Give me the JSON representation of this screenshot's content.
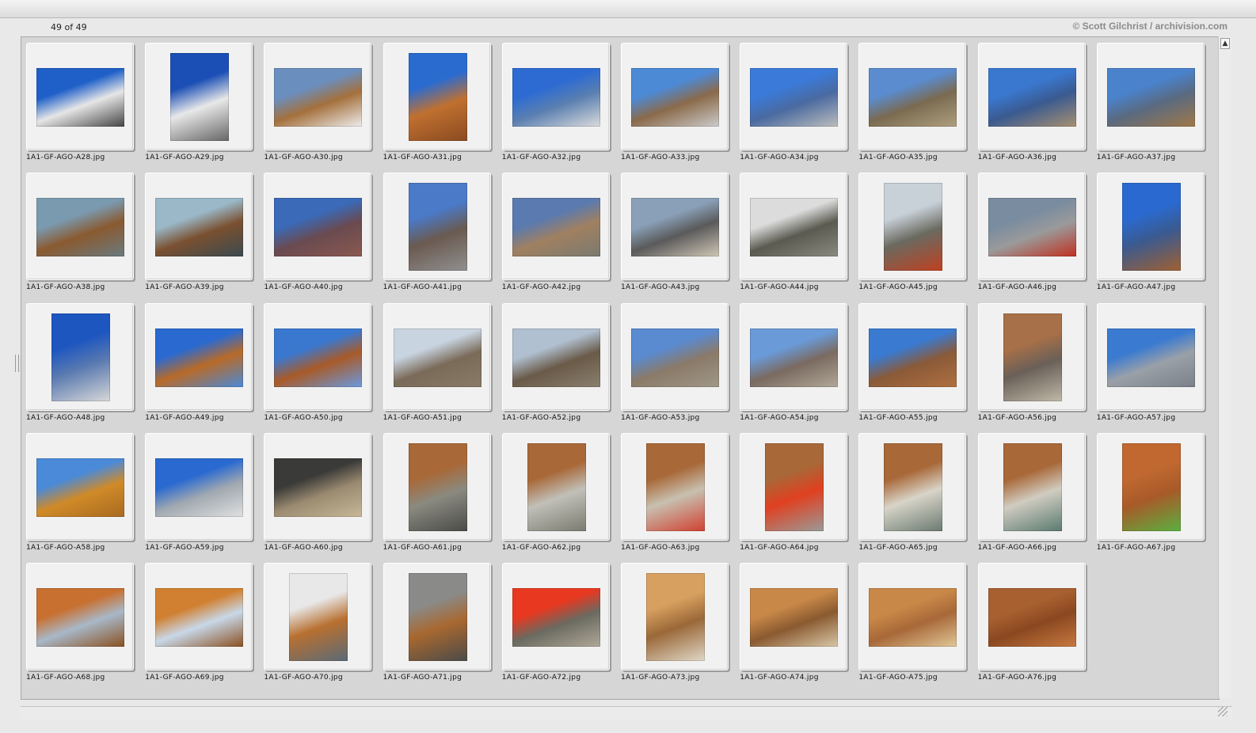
{
  "header": {
    "counter": "49 of 49",
    "credit": "© Scott Gilchrist / archivision.com"
  },
  "icons": {
    "scroll_up": "scroll-up-arrow-icon",
    "resize": "resize-grip-icon"
  },
  "thumbnails": [
    {
      "filename": "1A1-GF-AGO-A28.jpg",
      "orientation": "landscape",
      "colors": [
        "#1e5fc8",
        "#e6e6e6",
        "#444"
      ]
    },
    {
      "filename": "1A1-GF-AGO-A29.jpg",
      "orientation": "portrait",
      "colors": [
        "#1c4fb5",
        "#e8e8e8",
        "#666"
      ]
    },
    {
      "filename": "1A1-GF-AGO-A30.jpg",
      "orientation": "landscape",
      "colors": [
        "#6a8fbf",
        "#a4703c",
        "#ededed"
      ]
    },
    {
      "filename": "1A1-GF-AGO-A31.jpg",
      "orientation": "portrait",
      "colors": [
        "#2a6bd0",
        "#c07030",
        "#8a4a20"
      ]
    },
    {
      "filename": "1A1-GF-AGO-A32.jpg",
      "orientation": "landscape",
      "colors": [
        "#2d6bd3",
        "#5a7fb0",
        "#dcdcdc"
      ]
    },
    {
      "filename": "1A1-GF-AGO-A33.jpg",
      "orientation": "landscape",
      "colors": [
        "#4d8ad6",
        "#8a6a4a",
        "#cccccc"
      ]
    },
    {
      "filename": "1A1-GF-AGO-A34.jpg",
      "orientation": "landscape",
      "colors": [
        "#3b7ad8",
        "#4a6aa0",
        "#bdbdbd"
      ]
    },
    {
      "filename": "1A1-GF-AGO-A35.jpg",
      "orientation": "landscape",
      "colors": [
        "#5a8ccf",
        "#7a6a50",
        "#b0a080"
      ]
    },
    {
      "filename": "1A1-GF-AGO-A36.jpg",
      "orientation": "landscape",
      "colors": [
        "#3a78cf",
        "#3a5a90",
        "#a89070"
      ]
    },
    {
      "filename": "1A1-GF-AGO-A37.jpg",
      "orientation": "landscape",
      "colors": [
        "#4a82cc",
        "#5a6a80",
        "#a07848"
      ]
    },
    {
      "filename": "1A1-GF-AGO-A38.jpg",
      "orientation": "landscape",
      "colors": [
        "#7a9ab0",
        "#8a5a30",
        "#6a7a80"
      ]
    },
    {
      "filename": "1A1-GF-AGO-A39.jpg",
      "orientation": "landscape",
      "colors": [
        "#9ab8c8",
        "#7a5030",
        "#3a4a50"
      ]
    },
    {
      "filename": "1A1-GF-AGO-A40.jpg",
      "orientation": "landscape",
      "colors": [
        "#3a6ab8",
        "#6a4a50",
        "#8a5a50"
      ]
    },
    {
      "filename": "1A1-GF-AGO-A41.jpg",
      "orientation": "portrait",
      "colors": [
        "#4a7ac8",
        "#6a5a50",
        "#909090"
      ]
    },
    {
      "filename": "1A1-GF-AGO-A42.jpg",
      "orientation": "landscape",
      "colors": [
        "#5a7ab0",
        "#a08060",
        "#7a7a70"
      ]
    },
    {
      "filename": "1A1-GF-AGO-A43.jpg",
      "orientation": "landscape",
      "colors": [
        "#8aa0b8",
        "#5a5a5a",
        "#d0c8b8"
      ]
    },
    {
      "filename": "1A1-GF-AGO-A44.jpg",
      "orientation": "landscape",
      "colors": [
        "#dcdcdc",
        "#5a5a50",
        "#8a8a80"
      ]
    },
    {
      "filename": "1A1-GF-AGO-A45.jpg",
      "orientation": "portrait",
      "colors": [
        "#c8d0d8",
        "#6a6a60",
        "#c04020"
      ]
    },
    {
      "filename": "1A1-GF-AGO-A46.jpg",
      "orientation": "landscape",
      "colors": [
        "#7a8ca0",
        "#9a9a9a",
        "#c03020"
      ]
    },
    {
      "filename": "1A1-GF-AGO-A47.jpg",
      "orientation": "portrait",
      "colors": [
        "#2a6ad0",
        "#3a5a90",
        "#a06030"
      ]
    },
    {
      "filename": "1A1-GF-AGO-A48.jpg",
      "orientation": "portrait",
      "colors": [
        "#1e56c0",
        "#5a7ab0",
        "#d8d8d8"
      ]
    },
    {
      "filename": "1A1-GF-AGO-A49.jpg",
      "orientation": "landscape",
      "colors": [
        "#2a6ad0",
        "#b86a28",
        "#4a8ad8"
      ]
    },
    {
      "filename": "1A1-GF-AGO-A50.jpg",
      "orientation": "landscape",
      "colors": [
        "#3a78d0",
        "#a85a28",
        "#6a9ae0"
      ]
    },
    {
      "filename": "1A1-GF-AGO-A51.jpg",
      "orientation": "landscape",
      "colors": [
        "#c8d4e0",
        "#7a6a58",
        "#8a7a68"
      ]
    },
    {
      "filename": "1A1-GF-AGO-A52.jpg",
      "orientation": "landscape",
      "colors": [
        "#b0c0d0",
        "#6a5a48",
        "#8a8070"
      ]
    },
    {
      "filename": "1A1-GF-AGO-A53.jpg",
      "orientation": "landscape",
      "colors": [
        "#5a8ad0",
        "#8a7a68",
        "#a09888"
      ]
    },
    {
      "filename": "1A1-GF-AGO-A54.jpg",
      "orientation": "landscape",
      "colors": [
        "#6a9ad8",
        "#7a6a60",
        "#b0a898"
      ]
    },
    {
      "filename": "1A1-GF-AGO-A55.jpg",
      "orientation": "landscape",
      "colors": [
        "#3a7ad0",
        "#8a5a38",
        "#b07040"
      ]
    },
    {
      "filename": "1A1-GF-AGO-A56.jpg",
      "orientation": "portrait",
      "colors": [
        "#a87048",
        "#6a6058",
        "#c0b8a8"
      ]
    },
    {
      "filename": "1A1-GF-AGO-A57.jpg",
      "orientation": "landscape",
      "colors": [
        "#3a7ad0",
        "#9aa0a8",
        "#7a8088"
      ]
    },
    {
      "filename": "1A1-GF-AGO-A58.jpg",
      "orientation": "landscape",
      "colors": [
        "#4a8ad8",
        "#d08a28",
        "#a86a20"
      ]
    },
    {
      "filename": "1A1-GF-AGO-A59.jpg",
      "orientation": "landscape",
      "colors": [
        "#2a6ad0",
        "#a0a8b0",
        "#e0e0e0"
      ]
    },
    {
      "filename": "1A1-GF-AGO-A60.jpg",
      "orientation": "landscape",
      "colors": [
        "#3a3a38",
        "#9a8a70",
        "#c8b898"
      ]
    },
    {
      "filename": "1A1-GF-AGO-A61.jpg",
      "orientation": "portrait",
      "colors": [
        "#a86838",
        "#8a8a80",
        "#4a4a48"
      ]
    },
    {
      "filename": "1A1-GF-AGO-A62.jpg",
      "orientation": "portrait",
      "colors": [
        "#a86838",
        "#c0c0b8",
        "#7a7a70"
      ]
    },
    {
      "filename": "1A1-GF-AGO-A63.jpg",
      "orientation": "portrait",
      "colors": [
        "#a86838",
        "#c8c0b0",
        "#d04030"
      ]
    },
    {
      "filename": "1A1-GF-AGO-A64.jpg",
      "orientation": "portrait",
      "colors": [
        "#a86838",
        "#e04020",
        "#9a9a98"
      ]
    },
    {
      "filename": "1A1-GF-AGO-A65.jpg",
      "orientation": "portrait",
      "colors": [
        "#a86838",
        "#d8d4c8",
        "#6a7a70"
      ]
    },
    {
      "filename": "1A1-GF-AGO-A66.jpg",
      "orientation": "portrait",
      "colors": [
        "#a86838",
        "#d0ccc0",
        "#5a7a70"
      ]
    },
    {
      "filename": "1A1-GF-AGO-A67.jpg",
      "orientation": "portrait",
      "colors": [
        "#c06830",
        "#a85a28",
        "#5ab040"
      ]
    },
    {
      "filename": "1A1-GF-AGO-A68.jpg",
      "orientation": "landscape",
      "colors": [
        "#c87030",
        "#a8b8c8",
        "#8a5020"
      ]
    },
    {
      "filename": "1A1-GF-AGO-A69.jpg",
      "orientation": "landscape",
      "colors": [
        "#d08030",
        "#c8d8e8",
        "#8a5020"
      ]
    },
    {
      "filename": "1A1-GF-AGO-A70.jpg",
      "orientation": "portrait",
      "colors": [
        "#e8e8e8",
        "#b87030",
        "#5a6a78"
      ]
    },
    {
      "filename": "1A1-GF-AGO-A71.jpg",
      "orientation": "portrait",
      "colors": [
        "#8a8a88",
        "#a86830",
        "#4a4a48"
      ]
    },
    {
      "filename": "1A1-GF-AGO-A72.jpg",
      "orientation": "landscape",
      "colors": [
        "#e83820",
        "#6a6a60",
        "#b0a898"
      ]
    },
    {
      "filename": "1A1-GF-AGO-A73.jpg",
      "orientation": "portrait",
      "colors": [
        "#d8a060",
        "#9a6838",
        "#e0d8c8"
      ]
    },
    {
      "filename": "1A1-GF-AGO-A74.jpg",
      "orientation": "landscape",
      "colors": [
        "#c88848",
        "#8a5a30",
        "#d8c8a8"
      ]
    },
    {
      "filename": "1A1-GF-AGO-A75.jpg",
      "orientation": "landscape",
      "colors": [
        "#c88848",
        "#a86838",
        "#e0c898"
      ]
    },
    {
      "filename": "1A1-GF-AGO-A76.jpg",
      "orientation": "landscape",
      "colors": [
        "#a86030",
        "#8a4820",
        "#c87840"
      ]
    }
  ]
}
